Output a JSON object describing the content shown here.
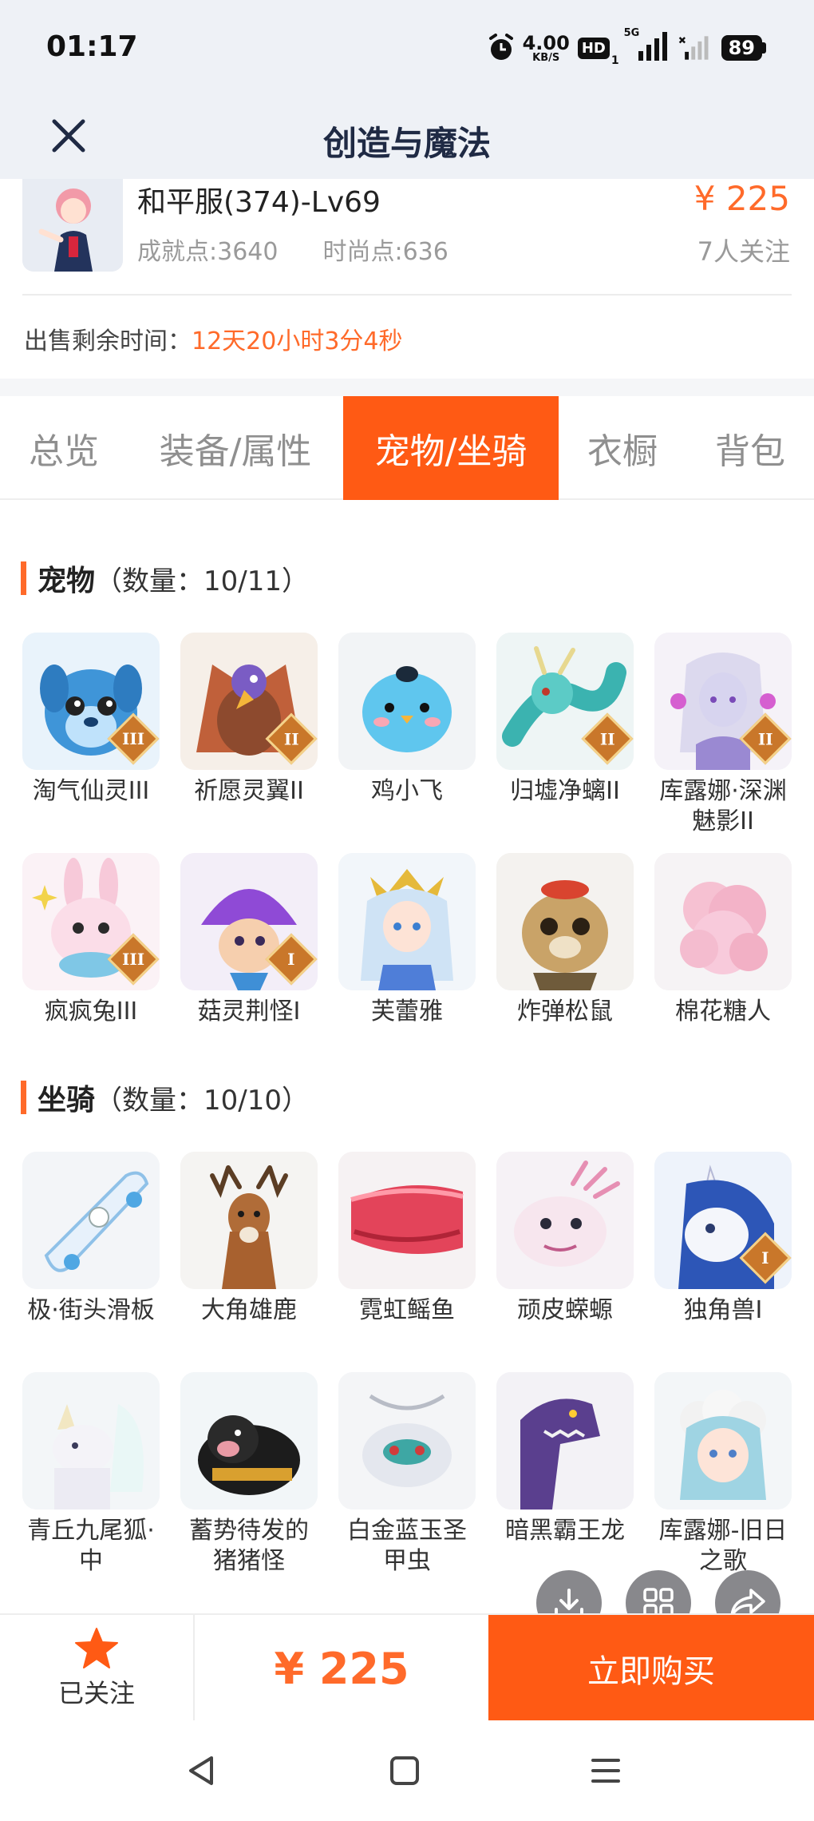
{
  "status_bar": {
    "time": "01:17",
    "net_speed_value": "4.00",
    "net_speed_unit": "KB/S",
    "hd_label": "HD",
    "hd_sub": "1",
    "network_label": "5G",
    "battery": "89"
  },
  "header": {
    "title": "创造与魔法"
  },
  "account": {
    "server": "和平服(374)-Lv69",
    "achievement": "成就点:3640",
    "fashion": "时尚点:636",
    "price": "¥ 225",
    "followers": "7人关注",
    "time_label": "出售剩余时间：",
    "time_value": "12天20小时3分4秒"
  },
  "tabs": [
    {
      "label": "总览"
    },
    {
      "label": "装备/属性"
    },
    {
      "label": "宠物/坐骑",
      "active": true
    },
    {
      "label": "衣橱"
    },
    {
      "label": "背包"
    }
  ],
  "pets": {
    "title": "宠物",
    "count": "（数量：10/11）",
    "items": [
      {
        "name": "淘气仙灵III",
        "icon": "blue-puppy-pet-icon",
        "tier": "III"
      },
      {
        "name": "祈愿灵翼II",
        "icon": "griffin-pet-icon",
        "tier": "II"
      },
      {
        "name": "鸡小飞",
        "icon": "blue-chick-pet-icon"
      },
      {
        "name": "归墟净螭II",
        "icon": "teal-dragon-pet-icon",
        "tier": "II"
      },
      {
        "name": "库露娜·深渊魅影II",
        "icon": "abyss-girl-pet-icon",
        "tier": "II"
      },
      {
        "name": "疯疯兔III",
        "icon": "pink-rabbit-pet-icon",
        "tier": "III"
      },
      {
        "name": "菇灵荆怪I",
        "icon": "mushroom-spirit-pet-icon",
        "tier": "I"
      },
      {
        "name": "芙蕾雅",
        "icon": "valkyrie-girl-pet-icon"
      },
      {
        "name": "炸弹松鼠",
        "icon": "bomb-squirrel-pet-icon"
      },
      {
        "name": "棉花糖人",
        "icon": "cotton-candy-pet-icon"
      }
    ]
  },
  "mounts": {
    "title": "坐骑",
    "count": "（数量：10/10）",
    "items": [
      {
        "name": "极·街头滑板",
        "icon": "skateboard-mount-icon"
      },
      {
        "name": "大角雄鹿",
        "icon": "deer-mount-icon"
      },
      {
        "name": "霓虹鳐鱼",
        "icon": "neon-ray-mount-icon"
      },
      {
        "name": "顽皮蝾螈",
        "icon": "axolotl-mount-icon"
      },
      {
        "name": "独角兽I",
        "icon": "unicorn-mount-icon",
        "tier": "I"
      },
      {
        "name": "青丘九尾狐·中",
        "icon": "nine-tail-fox-mount-icon"
      },
      {
        "name": "蓄势待发的猪猪怪",
        "icon": "pig-monster-mount-icon"
      },
      {
        "name": "白金蓝玉圣甲虫",
        "icon": "scarab-mount-icon"
      },
      {
        "name": "暗黑霸王龙",
        "icon": "dark-trex-mount-icon"
      },
      {
        "name": "库露娜-旧日之歌",
        "icon": "luna-song-mount-icon"
      }
    ]
  },
  "bottom": {
    "followed_label": "已关注",
    "price": "¥ 225",
    "buy_label": "立即购买"
  },
  "colors": {
    "accent": "#ff5a14",
    "price": "#ff6a2a",
    "header_bg": "#eef1f6"
  }
}
